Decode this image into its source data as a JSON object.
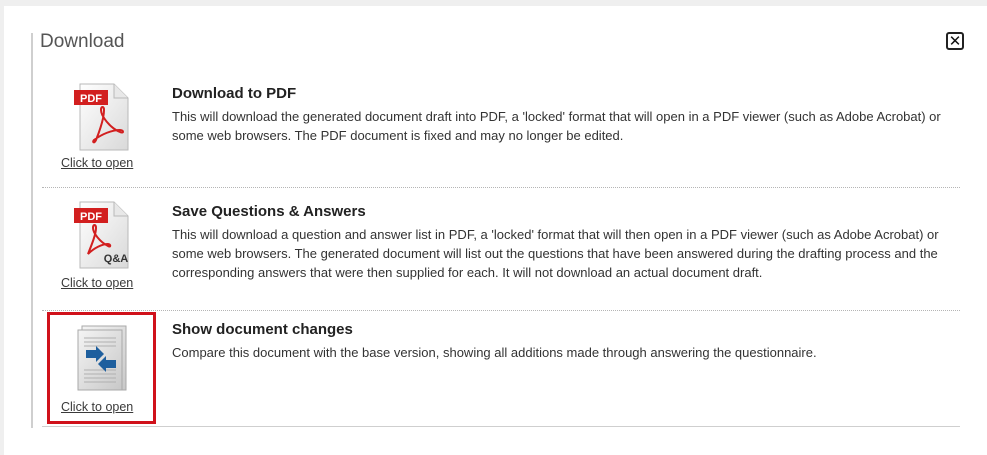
{
  "dialog": {
    "title": "Download",
    "close_symbol": "✕"
  },
  "options": [
    {
      "icon": "pdf-document-icon",
      "badge": "PDF",
      "link": "Click to open",
      "title": "Download to PDF",
      "description": "This will download the generated document draft into PDF, a 'locked' format that will open in a PDF viewer (such as Adobe Acrobat) or some web browsers. The PDF document is fixed and may no longer be edited."
    },
    {
      "icon": "pdf-qa-document-icon",
      "badge": "PDF",
      "subbadge": "Q&A",
      "link": "Click to open",
      "title": "Save Questions & Answers",
      "description": "This will download a question and answer list in PDF, a 'locked' format that will then open in a PDF viewer (such as Adobe Acrobat) or some web browsers. The generated document will list out the questions that have been answered during the drafting process and the corresponding answers that were then supplied for each. It will not download an actual document draft."
    },
    {
      "icon": "document-compare-icon",
      "link": "Click to open",
      "title": "Show document changes",
      "description": "Compare this document with the base version, showing all additions made through answering the questionnaire."
    }
  ],
  "colors": {
    "pdf_red": "#d21f1f",
    "highlight_red": "#d0111b",
    "compare_blue": "#1e5f9e"
  }
}
